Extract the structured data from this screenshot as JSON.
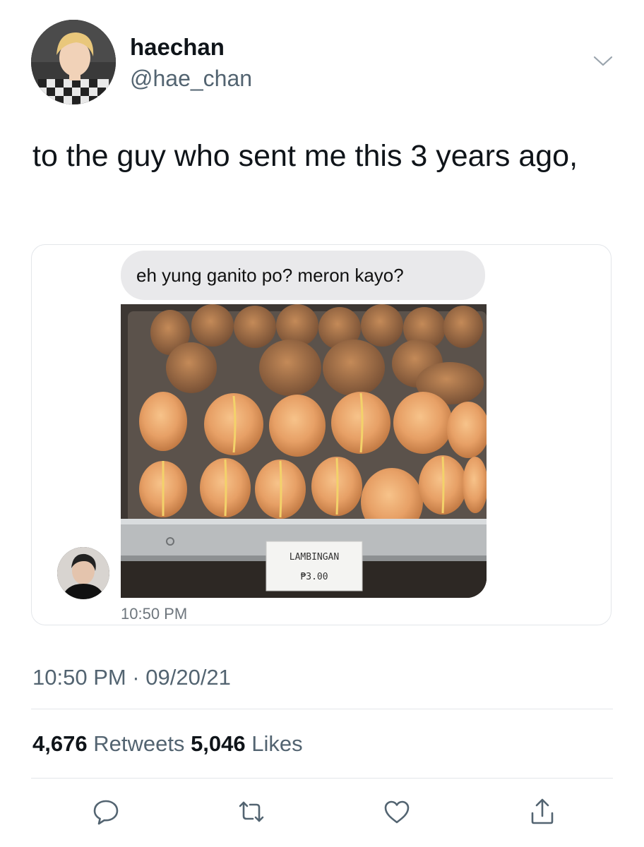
{
  "author": {
    "display_name": "haechan",
    "handle": "@hae_chan",
    "avatar_icon": "profile-photo"
  },
  "tweet": {
    "text": "to the guy who sent me this 3 years ago,"
  },
  "media": {
    "chat_message": "eh yung ganito po? meron kayo?",
    "chat_time": "10:50 PM",
    "photo_sign_line1": "LAMBINGAN",
    "photo_sign_line2": "₱3.00"
  },
  "meta": {
    "timestamp": "10:50 PM · 09/20/21"
  },
  "stats": {
    "retweets_count": "4,676",
    "retweets_label": "Retweets",
    "likes_count": "5,046",
    "likes_label": "Likes"
  },
  "actions": {
    "icons": [
      "reply-icon",
      "retweet-icon",
      "like-icon",
      "share-icon"
    ]
  },
  "colors": {
    "text_primary": "#0f1419",
    "text_secondary": "#536471",
    "bubble_gray": "#e9e9eb",
    "divider": "#e3e6ea"
  }
}
